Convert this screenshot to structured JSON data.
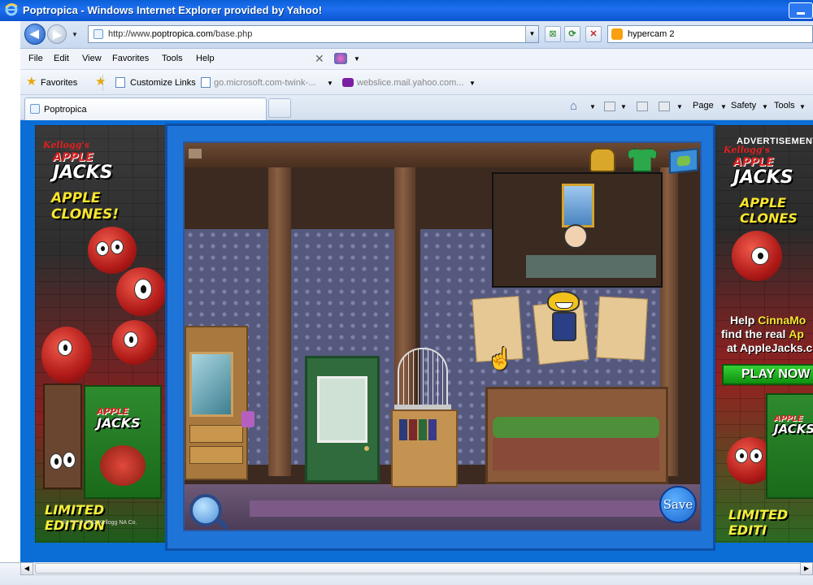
{
  "window": {
    "title": "Poptropica - Windows Internet Explorer provided by Yahoo!",
    "brand_color": "#0b55cf"
  },
  "address_bar": {
    "url_prefix": "http://www.",
    "url_host": "poptropica.com",
    "url_path": "/base.php",
    "search_query": "hypercam 2"
  },
  "menu": {
    "items": [
      "File",
      "Edit",
      "View",
      "Favorites",
      "Tools",
      "Help"
    ]
  },
  "favorites_bar": {
    "favorites_label": "Favorites",
    "customize_links": "Customize Links",
    "link_microsoft": "go.microsoft.com-twink-...",
    "link_yahoo": "webslice.mail.yahoo.com..."
  },
  "tabs": {
    "active_tab": "Poptropica"
  },
  "command_bar": {
    "page": "Page",
    "safety": "Safety",
    "tools": "Tools"
  },
  "ad_left": {
    "brand": "Kellogg's",
    "logo_apple": "APPLE",
    "logo_jacks": "JACKS",
    "clones": "APPLE CLONES!",
    "edition": "LIMITED EDITION",
    "copyright": "®, ™, © 2011 Kellogg NA Co."
  },
  "ad_right": {
    "label": "ADVERTISEMENT",
    "brand": "Kellogg's",
    "logo_apple": "APPLE",
    "logo_jacks": "JACKS",
    "clones": "APPLE CLONES",
    "help_line1_a": "Help ",
    "help_line1_b": "CinnaMo",
    "help_line2_a": "find the real ",
    "help_line2_b": "Ap",
    "help_line3": "at AppleJacks.c",
    "play_now": "PLAY NOW",
    "edition": "LIMITED EDITI"
  },
  "game": {
    "save_label": "Save",
    "hud_icons": [
      "backpack-icon",
      "costume-shirt-icon",
      "island-map-icon"
    ]
  }
}
